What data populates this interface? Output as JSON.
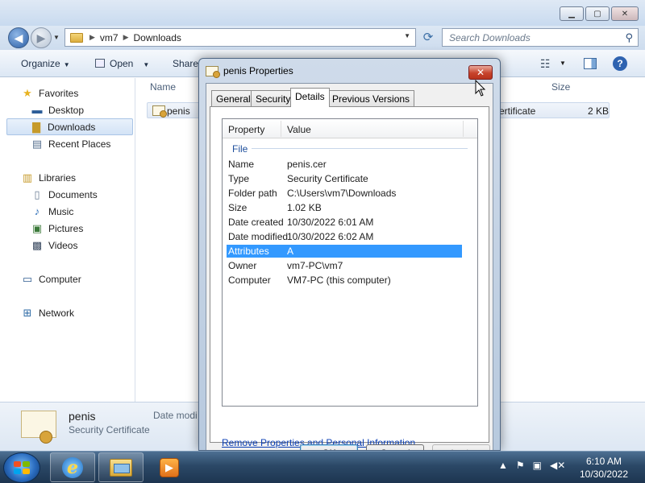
{
  "explorer": {
    "breadcrumb": [
      "vm7",
      "Downloads"
    ],
    "search_placeholder": "Search Downloads",
    "toolbar": {
      "organize": "Organize",
      "open": "Open",
      "share": "Share"
    },
    "columns": {
      "name": "Name",
      "size": "Size"
    },
    "file": {
      "name": "penis",
      "type_partial": "ertificate",
      "size": "2 KB"
    },
    "nav": {
      "favorites": "Favorites",
      "desktop": "Desktop",
      "downloads": "Downloads",
      "recent": "Recent Places",
      "libraries": "Libraries",
      "documents": "Documents",
      "music": "Music",
      "pictures": "Pictures",
      "videos": "Videos",
      "computer": "Computer",
      "network": "Network"
    },
    "details": {
      "name": "penis",
      "type": "Security Certificate",
      "date_label": "Date modi"
    }
  },
  "dialog": {
    "title": "penis Properties",
    "tabs": [
      "General",
      "Security",
      "Details",
      "Previous Versions"
    ],
    "active_tab": "Details",
    "columns": {
      "property": "Property",
      "value": "Value"
    },
    "group": "File",
    "rows": [
      {
        "key": "Name",
        "value": "penis.cer"
      },
      {
        "key": "Type",
        "value": "Security Certificate"
      },
      {
        "key": "Folder path",
        "value": "C:\\Users\\vm7\\Downloads"
      },
      {
        "key": "Size",
        "value": "1.02 KB"
      },
      {
        "key": "Date created",
        "value": "10/30/2022 6:01 AM"
      },
      {
        "key": "Date modified",
        "value": "10/30/2022 6:02 AM"
      },
      {
        "key": "Attributes",
        "value": "A"
      },
      {
        "key": "Owner",
        "value": "vm7-PC\\vm7"
      },
      {
        "key": "Computer",
        "value": "VM7-PC (this computer)"
      }
    ],
    "selected_row": "Attributes",
    "remove_link": "Remove Properties and Personal Information",
    "buttons": {
      "ok": "OK",
      "cancel": "Cancel",
      "apply": "Apply"
    }
  },
  "taskbar": {
    "time": "6:10 AM",
    "date": "10/30/2022"
  },
  "colors": {
    "selection": "#3399ff",
    "link": "#0b3fb5",
    "group_header": "#1e4f9c"
  }
}
